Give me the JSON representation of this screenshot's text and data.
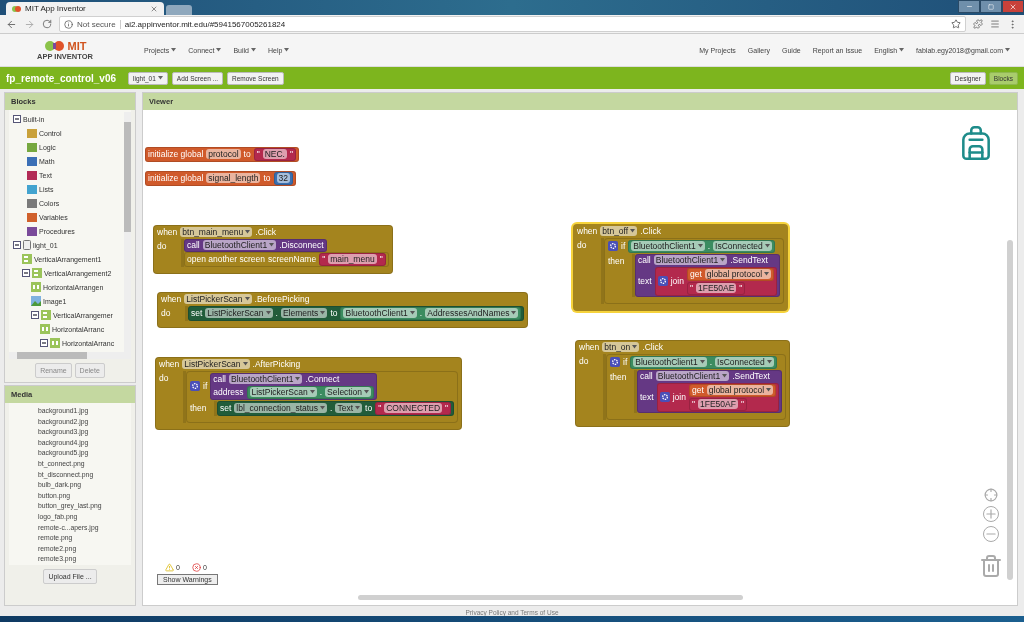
{
  "browser": {
    "tab": {
      "title": "MIT App Inventor"
    },
    "security": "Not secure",
    "url": "ai2.appinventor.mit.edu/#5941567005261824"
  },
  "header": {
    "logo": {
      "title": "MIT",
      "subtitle": "APP INVENTOR"
    },
    "menus": [
      {
        "label": "Projects",
        "dropdown": true
      },
      {
        "label": "Connect",
        "dropdown": true
      },
      {
        "label": "Build",
        "dropdown": true
      },
      {
        "label": "Help",
        "dropdown": true
      }
    ],
    "links": [
      {
        "label": "My Projects",
        "dropdown": false
      },
      {
        "label": "Gallery",
        "dropdown": false
      },
      {
        "label": "Guide",
        "dropdown": false
      },
      {
        "label": "Report an Issue",
        "dropdown": false
      },
      {
        "label": "English",
        "dropdown": true
      },
      {
        "label": "fablab.egy2018@gmail.com",
        "dropdown": true
      }
    ]
  },
  "project_bar": {
    "name": "fp_remote_control_v06",
    "screen": "light_01",
    "buttons": [
      "Add Screen ...",
      "Remove Screen"
    ],
    "views": [
      {
        "label": "Designer",
        "selected": false
      },
      {
        "label": "Blocks",
        "selected": true
      }
    ]
  },
  "blocks_panel": {
    "title": "Blocks",
    "tree": [
      {
        "label": "Built-in",
        "kind": "folder",
        "expanded": true,
        "children": [
          {
            "label": "Control",
            "kind": "drawer",
            "color": "#c9a13a"
          },
          {
            "label": "Logic",
            "kind": "drawer",
            "color": "#76a83f"
          },
          {
            "label": "Math",
            "kind": "drawer",
            "color": "#3b6fb6"
          },
          {
            "label": "Text",
            "kind": "drawer",
            "color": "#b22b56"
          },
          {
            "label": "Lists",
            "kind": "drawer",
            "color": "#43a3cf"
          },
          {
            "label": "Colors",
            "kind": "drawer",
            "color": "#7a7a7a"
          },
          {
            "label": "Variables",
            "kind": "drawer",
            "color": "#d0602b"
          },
          {
            "label": "Procedures",
            "kind": "drawer",
            "color": "#7a4a9a"
          }
        ]
      },
      {
        "label": "light_01",
        "kind": "screen",
        "expanded": true,
        "children": [
          {
            "label": "VerticalArrangement1",
            "kind": "vertical"
          },
          {
            "label": "VerticalArrangement2",
            "kind": "vertical",
            "expanded": true,
            "children": [
              {
                "label": "HorizontalArrangen",
                "kind": "horizontal"
              },
              {
                "label": "Image1",
                "kind": "image"
              },
              {
                "label": "VerticalArrangemer",
                "kind": "vertical",
                "expanded": true,
                "children": [
                  {
                    "label": "HorizontalArranc",
                    "kind": "horizontal"
                  },
                  {
                    "label": "HorizontalArranc",
                    "kind": "horizontal",
                    "expanded": true
                  }
                ]
              }
            ]
          }
        ]
      }
    ],
    "buttons": [
      "Rename",
      "Delete"
    ]
  },
  "media_panel": {
    "title": "Media",
    "files": [
      "background1.jpg",
      "background2.jpg",
      "background3.jpg",
      "background4.jpg",
      "background5.jpg",
      "bt_connect.png",
      "bt_disconnect.png",
      "bulb_dark.png",
      "button.png",
      "button_grey_last.png",
      "logo_fab.png",
      "remote-c...apers.jpg",
      "remote.png",
      "remote2.png",
      "remote3.png"
    ],
    "upload": "Upload File ..."
  },
  "viewer": {
    "title": "Viewer",
    "blocks": [
      {
        "kind": "variable",
        "selected": false,
        "lines": [
          [
            {
              "kind": "text",
              "text": "initialize global"
            },
            {
              "kind": "field",
              "text": "protocol",
              "dropdown": false
            },
            {
              "kind": "text",
              "text": "to"
            },
            {
              "kind": "block",
              "block": {
                "kind": "text",
                "lines": [
                  [
                    {
                      "kind": "text",
                      "text": "\""
                    },
                    {
                      "kind": "field",
                      "text": "NEC.",
                      "dropdown": false
                    },
                    {
                      "kind": "text",
                      "text": "\""
                    }
                  ]
                ]
              }
            }
          ]
        ]
      },
      {
        "kind": "variable",
        "selected": false,
        "lines": [
          [
            {
              "kind": "text",
              "text": "initialize global"
            },
            {
              "kind": "field",
              "text": "signal_length",
              "dropdown": false
            },
            {
              "kind": "text",
              "text": "to"
            },
            {
              "kind": "block",
              "block": {
                "kind": "math",
                "lines": [
                  [
                    {
                      "kind": "field",
                      "text": "32",
                      "dropdown": false
                    }
                  ]
                ]
              }
            }
          ]
        ]
      },
      {
        "kind": "event",
        "selected": false,
        "header": [
          {
            "kind": "text",
            "text": "when"
          },
          {
            "kind": "field",
            "text": "btn_main_menu",
            "dropdown": true
          },
          {
            "kind": "text",
            "text": ".Click"
          }
        ],
        "label": "do",
        "body": [
          {
            "kind": "method",
            "lines": [
              [
                {
                  "kind": "text",
                  "text": "call"
                },
                {
                  "kind": "field",
                  "text": "BluetoothClient1",
                  "dropdown": true
                },
                {
                  "kind": "text",
                  "text": ".Disconnect"
                }
              ]
            ]
          },
          {
            "kind": "control",
            "lines": [
              [
                {
                  "kind": "text",
                  "text": "open another screen"
                },
                {
                  "kind": "text",
                  "text": "screenName"
                },
                {
                  "kind": "block",
                  "block": {
                    "kind": "text",
                    "lines": [
                      [
                        {
                          "kind": "text",
                          "text": "\""
                        },
                        {
                          "kind": "field",
                          "text": "main_menu",
                          "dropdown": false
                        },
                        {
                          "kind": "text",
                          "text": "\""
                        }
                      ]
                    ]
                  }
                }
              ]
            ]
          }
        ]
      },
      {
        "kind": "event",
        "selected": false,
        "header": [
          {
            "kind": "text",
            "text": "when"
          },
          {
            "kind": "field",
            "text": "ListPickerScan",
            "dropdown": true
          },
          {
            "kind": "text",
            "text": ".BeforePicking"
          }
        ],
        "label": "do",
        "body": [
          {
            "kind": "setter",
            "lines": [
              [
                {
                  "kind": "text",
                  "text": "set"
                },
                {
                  "kind": "field",
                  "text": "ListPickerScan",
                  "dropdown": true
                },
                {
                  "kind": "text",
                  "text": "."
                },
                {
                  "kind": "field",
                  "text": "Elements",
                  "dropdown": true
                },
                {
                  "kind": "text",
                  "text": "to"
                },
                {
                  "kind": "block",
                  "block": {
                    "kind": "getter",
                    "lines": [
                      [
                        {
                          "kind": "field",
                          "text": "BluetoothClient1",
                          "dropdown": true
                        },
                        {
                          "kind": "text",
                          "text": "."
                        },
                        {
                          "kind": "field",
                          "text": "AddressesAndNames",
                          "dropdown": true
                        }
                      ]
                    ]
                  }
                }
              ]
            ]
          }
        ]
      },
      {
        "kind": "event",
        "selected": false,
        "header": [
          {
            "kind": "text",
            "text": "when"
          },
          {
            "kind": "field",
            "text": "ListPickerScan",
            "dropdown": true
          },
          {
            "kind": "text",
            "text": ".AfterPicking"
          }
        ],
        "label": "do",
        "body": [
          {
            "kind": "if",
            "header": [
              {
                "kind": "gear"
              },
              {
                "kind": "text",
                "text": "if"
              },
              {
                "kind": "block",
                "block": {
                  "kind": "method",
                  "lines": [
                    [
                      {
                        "kind": "text",
                        "text": "call"
                      },
                      {
                        "kind": "field",
                        "text": "BluetoothClient1",
                        "dropdown": true
                      },
                      {
                        "kind": "text",
                        "text": ".Connect"
                      }
                    ],
                    [
                      {
                        "kind": "text",
                        "text": "address"
                      },
                      {
                        "kind": "block",
                        "block": {
                          "kind": "getter",
                          "lines": [
                            [
                              {
                                "kind": "field",
                                "text": "ListPickerScan",
                                "dropdown": true
                              },
                              {
                                "kind": "text",
                                "text": "."
                              },
                              {
                                "kind": "field",
                                "text": "Selection",
                                "dropdown": true
                              }
                            ]
                          ]
                        }
                      }
                    ]
                  ]
                }
              }
            ],
            "label": "then",
            "body": [
              {
                "kind": "setter",
                "lines": [
                  [
                    {
                      "kind": "text",
                      "text": "set"
                    },
                    {
                      "kind": "field",
                      "text": "lbl_connection_status",
                      "dropdown": true
                    },
                    {
                      "kind": "text",
                      "text": "."
                    },
                    {
                      "kind": "field",
                      "text": "Text",
                      "dropdown": true
                    },
                    {
                      "kind": "text",
                      "text": "to"
                    },
                    {
                      "kind": "block",
                      "block": {
                        "kind": "text",
                        "lines": [
                          [
                            {
                              "kind": "text",
                              "text": "\""
                            },
                            {
                              "kind": "field",
                              "text": "CONNECTED",
                              "dropdown": false
                            },
                            {
                              "kind": "text",
                              "text": "\""
                            }
                          ]
                        ]
                      }
                    }
                  ]
                ]
              }
            ]
          }
        ]
      },
      {
        "kind": "event",
        "selected": true,
        "header": [
          {
            "kind": "text",
            "text": "when"
          },
          {
            "kind": "field",
            "text": "btn_off",
            "dropdown": true
          },
          {
            "kind": "text",
            "text": ".Click"
          }
        ],
        "label": "do",
        "body": [
          {
            "kind": "if",
            "header": [
              {
                "kind": "gear"
              },
              {
                "kind": "text",
                "text": "if"
              },
              {
                "kind": "block",
                "block": {
                  "kind": "getter",
                  "lines": [
                    [
                      {
                        "kind": "field",
                        "text": "BluetoothClient1",
                        "dropdown": true
                      },
                      {
                        "kind": "text",
                        "text": "."
                      },
                      {
                        "kind": "field",
                        "text": "IsConnected",
                        "dropdown": true
                      }
                    ]
                  ]
                }
              }
            ],
            "label": "then",
            "body": [
              {
                "kind": "method",
                "lines": [
                  [
                    {
                      "kind": "text",
                      "text": "call"
                    },
                    {
                      "kind": "field",
                      "text": "BluetoothClient1",
                      "dropdown": true
                    },
                    {
                      "kind": "text",
                      "text": ".SendText"
                    }
                  ],
                  [
                    {
                      "kind": "text",
                      "text": "text"
                    },
                    {
                      "kind": "block",
                      "block": {
                        "kind": "text",
                        "lines": [
                          [
                            {
                              "kind": "gear"
                            },
                            {
                              "kind": "text",
                              "text": "join"
                            },
                            {
                              "kind": "inputs",
                              "blocks": [
                                {
                                  "kind": "variable",
                                  "lines": [
                                    [
                                      {
                                        "kind": "text",
                                        "text": "get"
                                      },
                                      {
                                        "kind": "field",
                                        "text": "global protocol",
                                        "dropdown": true
                                      }
                                    ]
                                  ]
                                },
                                {
                                  "kind": "text",
                                  "lines": [
                                    [
                                      {
                                        "kind": "text",
                                        "text": "\""
                                      },
                                      {
                                        "kind": "field",
                                        "text": "1FE50AE",
                                        "dropdown": false
                                      },
                                      {
                                        "kind": "text",
                                        "text": "\""
                                      }
                                    ]
                                  ]
                                }
                              ]
                            }
                          ]
                        ]
                      }
                    }
                  ]
                ]
              }
            ]
          }
        ]
      },
      {
        "kind": "event",
        "selected": false,
        "header": [
          {
            "kind": "text",
            "text": "when"
          },
          {
            "kind": "field",
            "text": "btn_on",
            "dropdown": true
          },
          {
            "kind": "text",
            "text": ".Click"
          }
        ],
        "label": "do",
        "body": [
          {
            "kind": "if",
            "header": [
              {
                "kind": "gear"
              },
              {
                "kind": "text",
                "text": "if"
              },
              {
                "kind": "block",
                "block": {
                  "kind": "getter",
                  "lines": [
                    [
                      {
                        "kind": "field",
                        "text": "BluetoothClient1",
                        "dropdown": true
                      },
                      {
                        "kind": "text",
                        "text": "."
                      },
                      {
                        "kind": "field",
                        "text": "IsConnected",
                        "dropdown": true
                      }
                    ]
                  ]
                }
              }
            ],
            "label": "then",
            "body": [
              {
                "kind": "method",
                "lines": [
                  [
                    {
                      "kind": "text",
                      "text": "call"
                    },
                    {
                      "kind": "field",
                      "text": "BluetoothClient1",
                      "dropdown": true
                    },
                    {
                      "kind": "text",
                      "text": ".SendText"
                    }
                  ],
                  [
                    {
                      "kind": "text",
                      "text": "text"
                    },
                    {
                      "kind": "block",
                      "block": {
                        "kind": "text",
                        "lines": [
                          [
                            {
                              "kind": "gear"
                            },
                            {
                              "kind": "text",
                              "text": "join"
                            },
                            {
                              "kind": "inputs",
                              "blocks": [
                                {
                                  "kind": "variable",
                                  "lines": [
                                    [
                                      {
                                        "kind": "text",
                                        "text": "get"
                                      },
                                      {
                                        "kind": "field",
                                        "text": "global protocol",
                                        "dropdown": true
                                      }
                                    ]
                                  ]
                                },
                                {
                                  "kind": "text",
                                  "lines": [
                                    [
                                      {
                                        "kind": "text",
                                        "text": "\""
                                      },
                                      {
                                        "kind": "field",
                                        "text": "1FE50AF",
                                        "dropdown": false
                                      },
                                      {
                                        "kind": "text",
                                        "text": "\""
                                      }
                                    ]
                                  ]
                                }
                              ]
                            }
                          ]
                        ]
                      }
                    }
                  ]
                ]
              }
            ]
          }
        ]
      }
    ],
    "warnings": {
      "warning_count": "0",
      "error_count": "0",
      "button": "Show Warnings"
    }
  },
  "footer": "Privacy Policy and Terms of Use"
}
